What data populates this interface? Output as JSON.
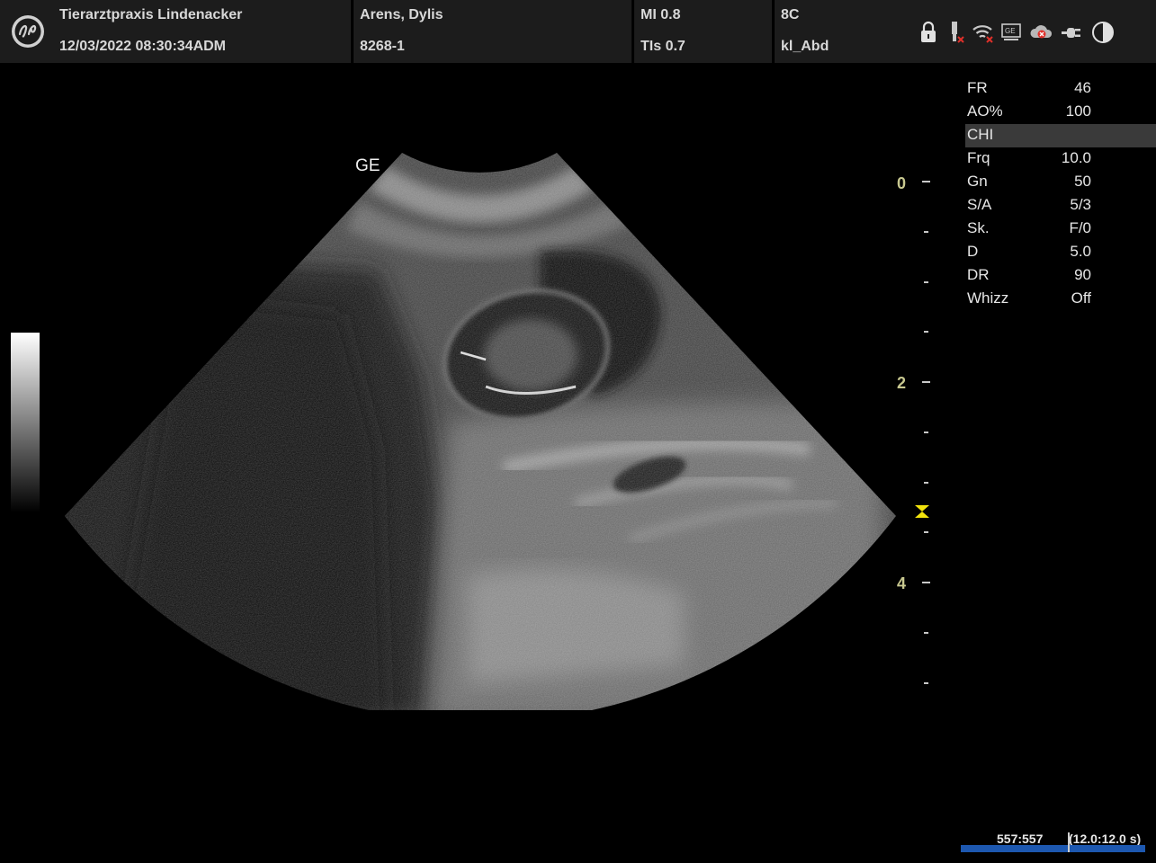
{
  "header": {
    "clinic": "Tierarztpraxis Lindenacker",
    "datetime": "12/03/2022 08:30:34ADM",
    "patient_name": "Arens, Dylis",
    "patient_id": "8268-1",
    "mi": "MI 0.8",
    "tis": "TIs 0.7",
    "probe": "8C",
    "preset": "kl_Abd",
    "status_icons": [
      "lock-icon",
      "probe-disconnected-icon",
      "wifi-off-icon",
      "ge-network-icon",
      "cloud-off-icon",
      "plug-icon",
      "contrast-icon"
    ]
  },
  "image_label": "GE",
  "params": [
    {
      "key": "FR",
      "value": "46"
    },
    {
      "key": "AO%",
      "value": "100"
    },
    {
      "key": "CHI",
      "value": "",
      "highlight": true
    },
    {
      "key": "Frq",
      "value": "10.0"
    },
    {
      "key": "Gn",
      "value": "50"
    },
    {
      "key": "S/A",
      "value": "5/3"
    },
    {
      "key": "Sk.",
      "value": "F/0"
    },
    {
      "key": "D",
      "value": "5.0"
    },
    {
      "key": "DR",
      "value": "90"
    },
    {
      "key": "Whizz",
      "value": "Off"
    }
  ],
  "depth_scale": {
    "labels": [
      "0",
      "2",
      "4"
    ],
    "focus_depth": 3.3
  },
  "cine": {
    "frames": "557:557",
    "time": "(12.0:12.0 s)"
  },
  "colors": {
    "header_bg": "#1c1c1c",
    "scale_label": "#c8c890",
    "focus_marker": "#f2e30c",
    "cine_bar": "#1d58b0"
  }
}
